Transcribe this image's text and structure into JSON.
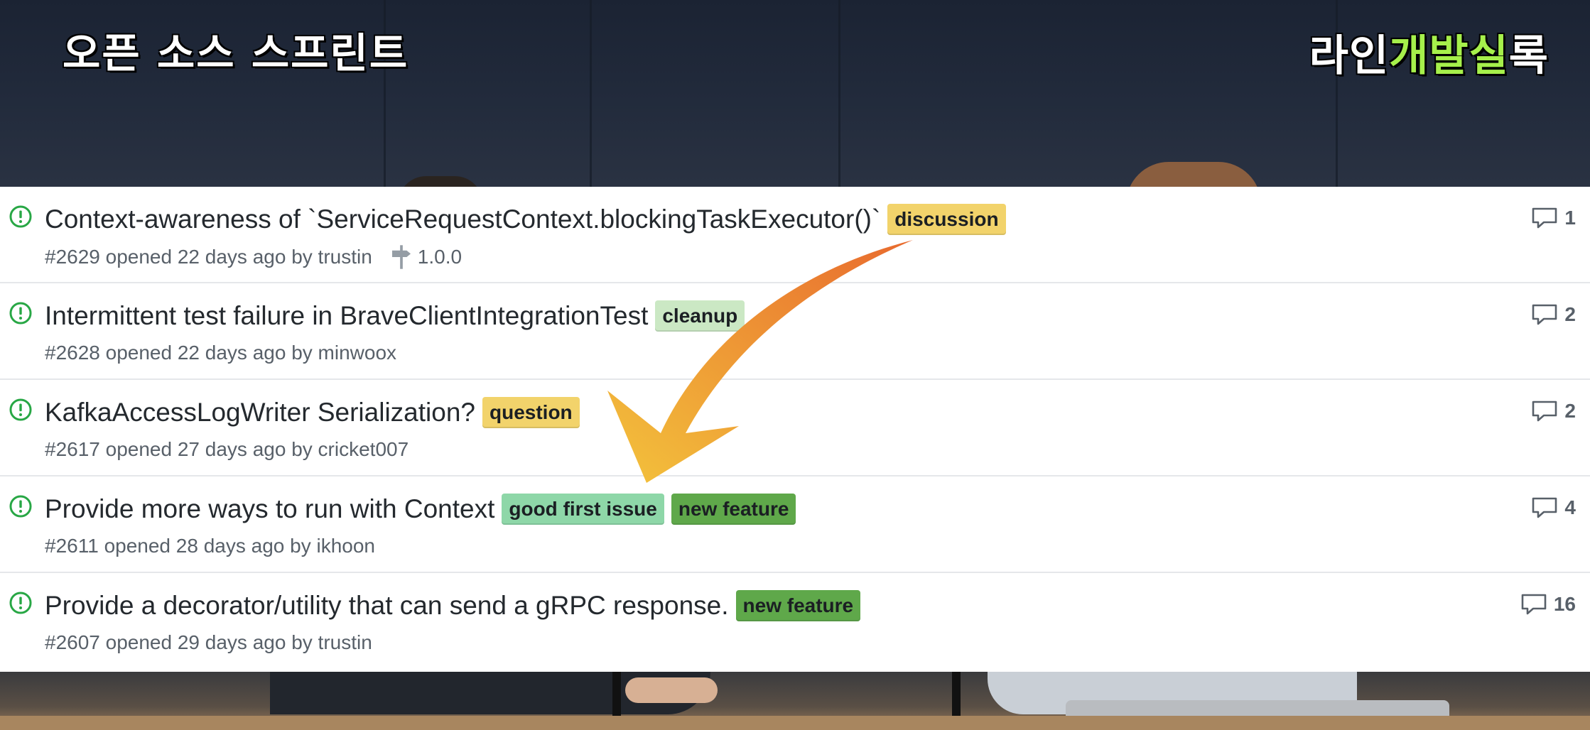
{
  "overlay": {
    "caption_left": "오픈 소스 스프린트",
    "caption_right_white_1": "라인",
    "caption_right_green": "개발실",
    "caption_right_white_2": "록"
  },
  "issues": [
    {
      "title": "Context-awareness of `ServiceRequestContext.blockingTaskExecutor()`",
      "labels": [
        {
          "text": "discussion",
          "color": "#f2d36b"
        }
      ],
      "meta": "#2629 opened 22 days ago by trustin",
      "milestone": "1.0.0",
      "comments": "1"
    },
    {
      "title": "Intermittent test failure in BraveClientIntegrationTest",
      "labels": [
        {
          "text": "cleanup",
          "color": "#cbe8c4"
        }
      ],
      "meta": "#2628 opened 22 days ago by minwoox",
      "comments": "2"
    },
    {
      "title": "KafkaAccessLogWriter Serialization?",
      "labels": [
        {
          "text": "question",
          "color": "#f2d36b"
        }
      ],
      "meta": "#2617 opened 27 days ago by cricket007",
      "comments": "2"
    },
    {
      "title": "Provide more ways to run with Context",
      "labels": [
        {
          "text": "good first issue",
          "color": "#8ed7a8"
        },
        {
          "text": "new feature",
          "color": "#5fa84a"
        }
      ],
      "meta": "#2611 opened 28 days ago by ikhoon",
      "comments": "4"
    },
    {
      "title": "Provide a decorator/utility that can send a gRPC response.",
      "labels": [
        {
          "text": "new feature",
          "color": "#5fa84a"
        }
      ],
      "meta": "#2607 opened 29 days ago by trustin",
      "comments": "16"
    }
  ],
  "colors": {
    "open_icon": "#28a745",
    "arrow_start": "#e86a2e",
    "arrow_end": "#f3c33c"
  },
  "icons": {
    "open": "issue-opened-icon",
    "milestone": "milestone-icon",
    "comment": "comment-icon"
  }
}
